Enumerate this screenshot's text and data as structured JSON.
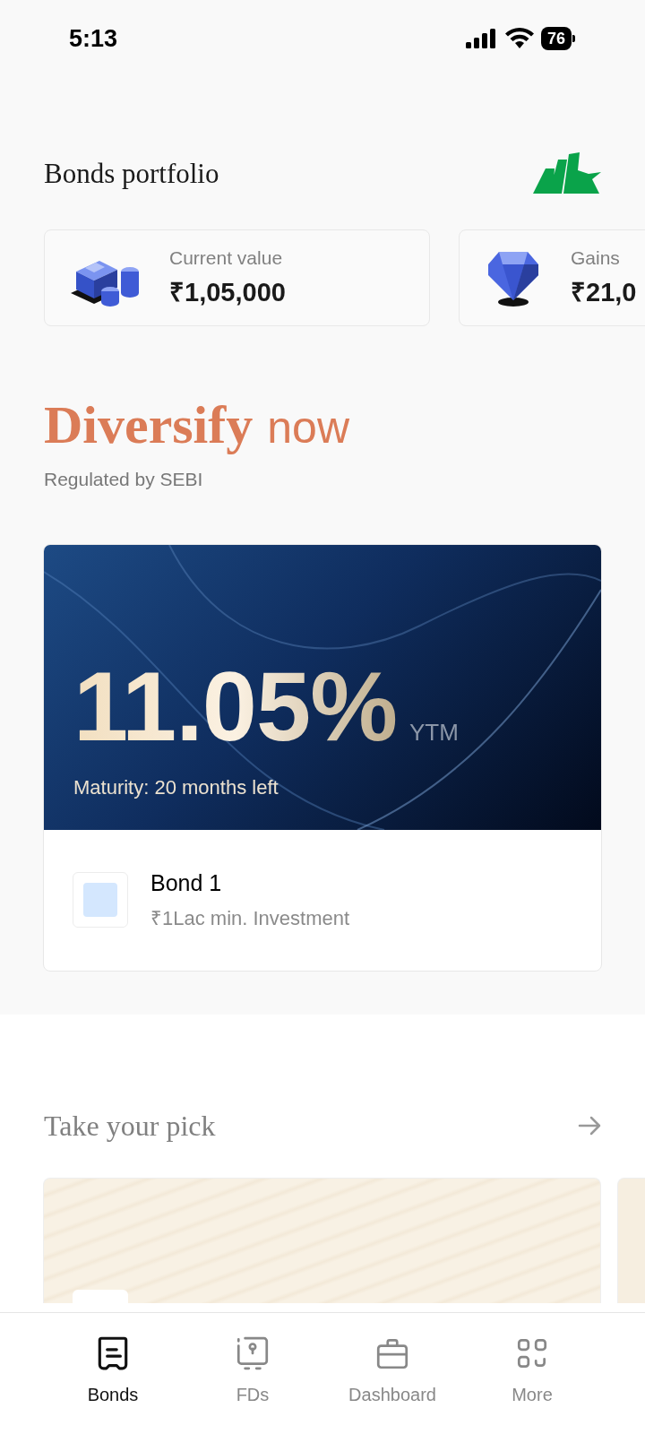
{
  "status_bar": {
    "time": "5:13",
    "battery": "76"
  },
  "header": {
    "title": "Bonds portfolio"
  },
  "stats": [
    {
      "label": "Current value",
      "value": "₹1,05,000",
      "kind": "money"
    },
    {
      "label": "Gains",
      "value": "₹21,0",
      "kind": "gem"
    }
  ],
  "promo": {
    "headline_bold": "Diversify",
    "headline_light": "now",
    "subtitle": "Regulated by SEBI"
  },
  "featured_bond": {
    "rate": "11.05%",
    "rate_suffix": "YTM",
    "maturity": "Maturity: 20 months left",
    "name": "Bond 1",
    "min_investment": "₹1Lac min. Investment"
  },
  "picks": {
    "title": "Take your pick"
  },
  "tabs": [
    {
      "label": "Bonds",
      "selected": true,
      "kind": "bonds"
    },
    {
      "label": "FDs",
      "selected": false,
      "kind": "fds"
    },
    {
      "label": "Dashboard",
      "selected": false,
      "kind": "dashboard"
    },
    {
      "label": "More",
      "selected": false,
      "kind": "more"
    }
  ]
}
